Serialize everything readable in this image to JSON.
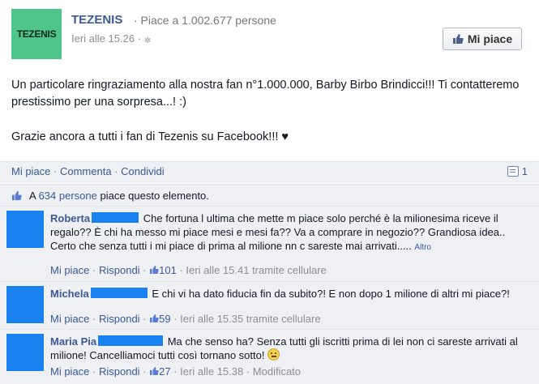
{
  "page": {
    "logo_text": "TEZENIS",
    "name": "TEZENIS",
    "likes_meta": "· Piace a 1.002.677 persone",
    "time": "Ieri alle 15.26 ·",
    "like_button_label": "Mi piace"
  },
  "post": {
    "line1": "Un particolare ringraziamento alla nostra fan n°1.000.000, Barby Birbo Brindicci!!! Ti contatteremo prestissimo per una sorpresa...! :)",
    "line2": "Grazie ancora a tutti i fan di Tezenis su Facebook!!! ♥"
  },
  "actions": {
    "like": "Mi piace",
    "sep1": " · ",
    "comment": "Commenta",
    "sep2": " · ",
    "share": "Condividi",
    "comment_count": "1"
  },
  "likes": {
    "prefix": "A ",
    "count_link": "634 persone",
    "suffix": " piace questo elemento."
  },
  "comments": [
    {
      "author": "Roberta",
      "text": "Che fortuna l ultima che mette m piace solo perché è la milionesima riceve il regalo?? È chi ha messo mi piace mesi e mesi fa?? Va a comprare in negozio?? Grandiosa idea.. Certo che senza tutti i mi piace di prima al milione nn c sareste mai arrivati.....",
      "more": "Altro",
      "like": "Mi piace",
      "reply": "Rispondi",
      "likes": "101",
      "time": "Ieri alle 15.41 tramite cellulare"
    },
    {
      "author": "Michela",
      "text": "E chi vi ha dato fiducia fin da subito?! E non dopo 1 milione di altri mi piace?!",
      "like": "Mi piace",
      "reply": "Rispondi",
      "likes": "59",
      "time": "Ieri alle 15.35 tramite cellulare"
    },
    {
      "author": "Maria Pia",
      "text": "Ma che senso ha? Senza tutti gli iscritti prima di lei non ci sareste arrivati al milione! Cancelliamoci tutti così tornano sotto!",
      "like": "Mi piace",
      "reply": "Rispondi",
      "likes": "27",
      "time": "Ieri alle 15.38 · Modificato"
    }
  ],
  "colors": {
    "link": "#3b5998",
    "logo_bg": "#4fc58a",
    "redaction": "#1a82f0",
    "feedback_bg": "#eef0f4"
  }
}
